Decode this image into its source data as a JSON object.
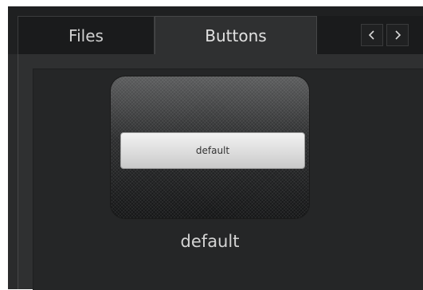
{
  "tabs": [
    {
      "label": "Files",
      "active": false
    },
    {
      "label": "Buttons",
      "active": true
    }
  ],
  "nav": {
    "prev_icon": "chevron-left-icon",
    "next_icon": "chevron-right-icon"
  },
  "preview": {
    "button_label": "default",
    "caption": "default"
  }
}
